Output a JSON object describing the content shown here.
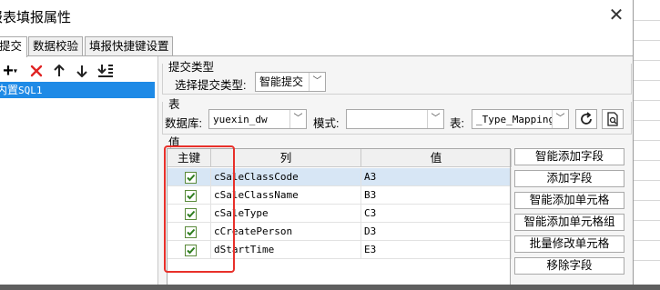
{
  "window": {
    "title": "报表填报属性",
    "close_glyph": "✕"
  },
  "tabs": [
    {
      "label": "提交",
      "active": true
    },
    {
      "label": "数据校验",
      "active": false
    },
    {
      "label": "填报快捷键设置",
      "active": false
    }
  ],
  "toolbar": {
    "add_icon": "plus-icon",
    "delete_icon": "red-x-icon",
    "up_icon": "arrow-up-icon",
    "down_icon": "arrow-down-icon",
    "bottom_icon": "move-bottom-icon"
  },
  "tree": {
    "items": [
      {
        "prefix": "内置",
        "name": "SQL1",
        "selected": true
      }
    ]
  },
  "submit_type": {
    "group_label": "提交类型",
    "select_label": "选择提交类型:",
    "value": "智能提交"
  },
  "table_section": {
    "group_label": "表",
    "db_label": "数据库:",
    "db_value": "yuexin_dw",
    "schema_label": "模式:",
    "schema_value": "",
    "table_label": "表:",
    "table_value": "_Type_Mapping"
  },
  "value_section": {
    "group_label": "值",
    "columns": [
      "主键",
      "列",
      "值"
    ],
    "rows": [
      {
        "pk": true,
        "col": "cSaleClassCode",
        "val": "A3"
      },
      {
        "pk": true,
        "col": "cSaleClassName",
        "val": "B3"
      },
      {
        "pk": true,
        "col": "cSaleType",
        "val": "C3"
      },
      {
        "pk": true,
        "col": "cCreatePerson",
        "val": "D3"
      },
      {
        "pk": true,
        "col": "dStartTime",
        "val": "E3"
      }
    ]
  },
  "side_buttons": [
    "智能添加字段",
    "添加字段",
    "智能添加单元格",
    "智能添加单元格组",
    "批量修改单元格",
    "移除字段"
  ],
  "colors": {
    "selection": "#1e8ae6",
    "highlight_box": "#e8302a",
    "delete_red": "#e02424"
  }
}
